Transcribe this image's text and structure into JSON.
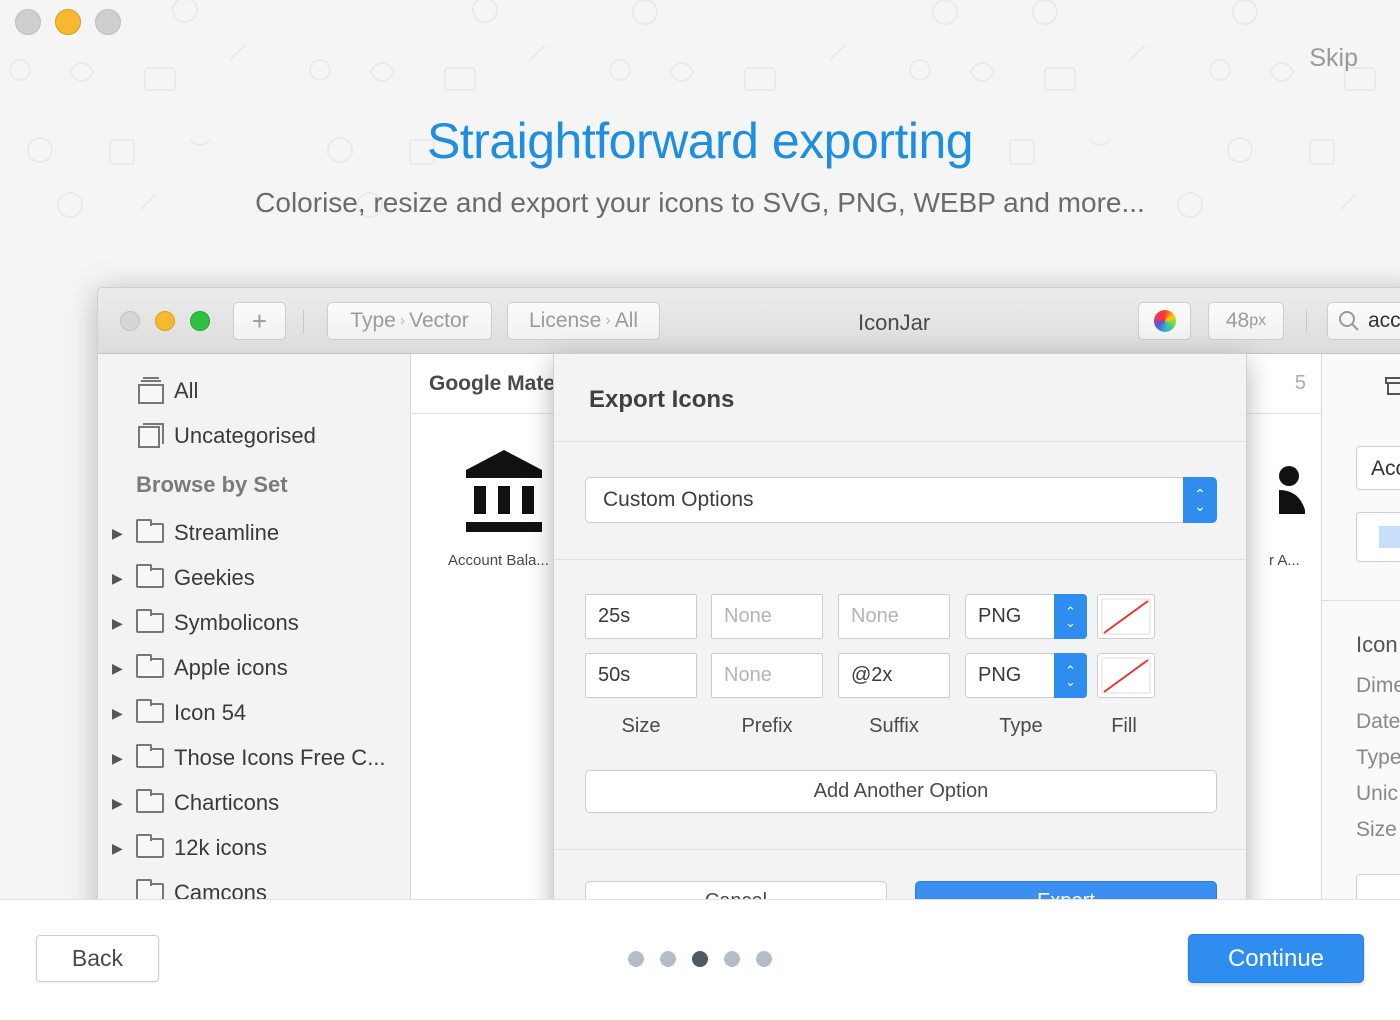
{
  "window": {
    "skip_label": "Skip"
  },
  "hero": {
    "title": "Straightforward exporting",
    "subtitle": "Colorise, resize and export your icons to SVG, PNG, WEBP and more..."
  },
  "app": {
    "title": "IconJar",
    "toolbar": {
      "add_label": "+",
      "type_filter": {
        "key": "Type",
        "value": "Vector"
      },
      "license_filter": {
        "key": "License",
        "value": "All"
      },
      "size_value": "48",
      "size_unit": "px",
      "search_text": "acc"
    },
    "sidebar": {
      "top_items": [
        {
          "label": "All"
        },
        {
          "label": "Uncategorised"
        }
      ],
      "section_title": "Browse by Set",
      "sets": [
        {
          "label": "Streamline"
        },
        {
          "label": "Geekies"
        },
        {
          "label": "Symbolicons"
        },
        {
          "label": "Apple icons"
        },
        {
          "label": "Icon 54"
        },
        {
          "label": "Those Icons Free C..."
        },
        {
          "label": "Charticons"
        },
        {
          "label": "12k icons"
        },
        {
          "label": "Camcons"
        }
      ]
    },
    "content": {
      "title": "Google Mate",
      "count": "5",
      "icons": [
        {
          "icon": "bank-icon",
          "label": "Account Bala..."
        },
        {
          "icon": "person-icon",
          "label": "r A..."
        }
      ]
    },
    "right_panel": {
      "button_text": "Acc",
      "section_title": "Icon",
      "rows": [
        "Dime",
        "Date",
        "Type",
        "Unic",
        "Size"
      ]
    }
  },
  "dialog": {
    "title": "Export Icons",
    "preset": "Custom Options",
    "rows": [
      {
        "size": "25s",
        "prefix": "None",
        "suffix": "None",
        "type": "PNG"
      },
      {
        "size": "50s",
        "prefix": "None",
        "suffix": "@2x",
        "type": "PNG"
      }
    ],
    "columns": [
      "Size",
      "Prefix",
      "Suffix",
      "Type",
      "Fill"
    ],
    "add_option_label": "Add Another Option",
    "cancel_label": "Cancel",
    "export_label": "Export"
  },
  "footer": {
    "back_label": "Back",
    "continue_label": "Continue",
    "page_count": 5,
    "active_page": 3
  },
  "colors": {
    "accent": "#2f8df0",
    "title_blue": "#1e8fe0"
  }
}
